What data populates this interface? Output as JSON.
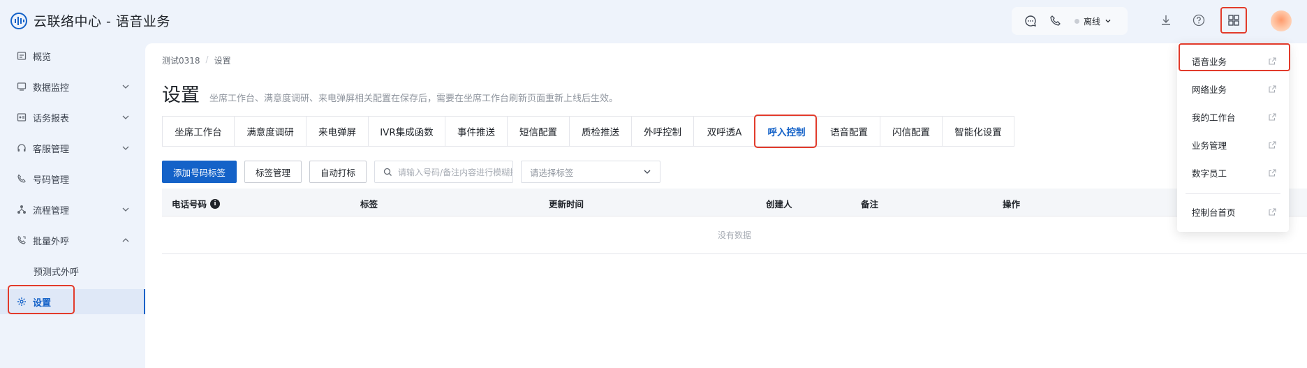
{
  "app": {
    "title": "云联络中心 - 语音业务"
  },
  "topbar": {
    "status": "离线"
  },
  "sidebar": {
    "items": [
      {
        "label": "概览"
      },
      {
        "label": "数据监控"
      },
      {
        "label": "话务报表"
      },
      {
        "label": "客服管理"
      },
      {
        "label": "号码管理"
      },
      {
        "label": "流程管理"
      },
      {
        "label": "批量外呼"
      },
      {
        "label": "预测式外呼"
      },
      {
        "label": "设置"
      }
    ]
  },
  "breadcrumb": {
    "items": [
      "测试0318",
      "设置"
    ]
  },
  "page": {
    "title": "设置",
    "description": "坐席工作台、满意度调研、来电弹屏相关配置在保存后，需要在坐席工作台刷新页面重新上线后生效。"
  },
  "tabs": [
    "坐席工作台",
    "满意度调研",
    "来电弹屏",
    "IVR集成函数",
    "事件推送",
    "短信配置",
    "质检推送",
    "外呼控制",
    "双呼透A",
    "呼入控制",
    "语音配置",
    "闪信配置",
    "智能化设置"
  ],
  "active_tab": "呼入控制",
  "toolbar": {
    "add_label": "添加号码标签",
    "manage_label": "标签管理",
    "auto_label": "自动打标",
    "search_placeholder": "请输入号码/备注内容进行模糊搜索",
    "select_placeholder": "请选择标签"
  },
  "table": {
    "columns": [
      "电话号码",
      "标签",
      "更新时间",
      "创建人",
      "备注",
      "操作"
    ],
    "empty_text": "没有数据"
  },
  "dropdown": {
    "items": [
      "语音业务",
      "网络业务",
      "我的工作台",
      "业务管理",
      "数字员工"
    ],
    "footer": "控制台首页"
  },
  "colors": {
    "primary": "#1462c8",
    "highlight": "#e23b2b",
    "background": "#eef3fb"
  }
}
